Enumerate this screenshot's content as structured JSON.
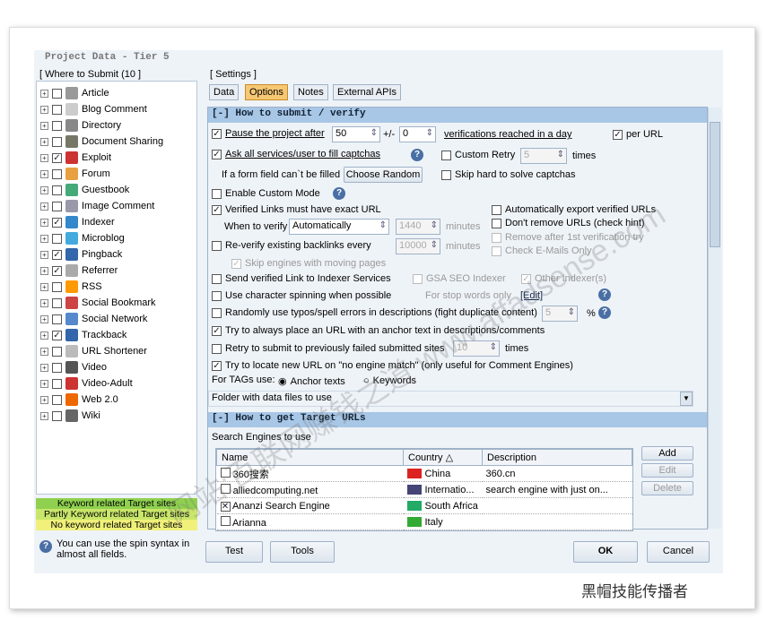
{
  "window": {
    "title": "Project Data - Tier 5"
  },
  "left": {
    "header": "[ Where to Submit  (10 ]",
    "items": [
      {
        "label": "Article",
        "checked": false,
        "color": "#999"
      },
      {
        "label": "Blog Comment",
        "checked": false,
        "color": "#ccc"
      },
      {
        "label": "Directory",
        "checked": false,
        "color": "#888"
      },
      {
        "label": "Document Sharing",
        "checked": false,
        "color": "#776"
      },
      {
        "label": "Exploit",
        "checked": true,
        "color": "#c33"
      },
      {
        "label": "Forum",
        "checked": false,
        "color": "#e8a040"
      },
      {
        "label": "Guestbook",
        "checked": false,
        "color": "#4a7"
      },
      {
        "label": "Image Comment",
        "checked": false,
        "color": "#99a"
      },
      {
        "label": "Indexer",
        "checked": true,
        "color": "#38c"
      },
      {
        "label": "Microblog",
        "checked": false,
        "color": "#4ad"
      },
      {
        "label": "Pingback",
        "checked": true,
        "color": "#36a"
      },
      {
        "label": "Referrer",
        "checked": true,
        "color": "#aaa"
      },
      {
        "label": "RSS",
        "checked": false,
        "color": "#f90"
      },
      {
        "label": "Social Bookmark",
        "checked": false,
        "color": "#c44"
      },
      {
        "label": "Social Network",
        "checked": false,
        "color": "#58c"
      },
      {
        "label": "Trackback",
        "checked": true,
        "color": "#36a"
      },
      {
        "label": "URL Shortener",
        "checked": false,
        "color": "#bbb"
      },
      {
        "label": "Video",
        "checked": false,
        "color": "#555"
      },
      {
        "label": "Video-Adult",
        "checked": false,
        "color": "#c33"
      },
      {
        "label": "Web 2.0",
        "checked": false,
        "color": "#e60"
      },
      {
        "label": "Wiki",
        "checked": false,
        "color": "#666"
      }
    ],
    "legend": [
      "Keyword related Target sites",
      "Partly Keyword related Target sites",
      "No keyword related Target sites"
    ],
    "hint": "You can use the spin syntax in almost all fields."
  },
  "settings": {
    "header": "[ Settings ]",
    "tabs": [
      "Data",
      "Options",
      "Notes",
      "External APIs"
    ],
    "active_tab": "Options"
  },
  "submit": {
    "header": "[-] How to submit / verify",
    "pause_label": "Pause the project after",
    "pause_value": "50",
    "plusminus": "+/-",
    "pause_var": "0",
    "verif_label": "verifications reached in a day",
    "per_url": "per URL",
    "ask_captcha": "Ask all services/user to fill captchas",
    "custom_retry": "Custom Retry",
    "retry_value": "5",
    "times": "times",
    "form_field": "If a form field can`t be filled",
    "choose_random": "Choose Random",
    "skip_hard": "Skip hard to solve captchas",
    "custom_mode": "Enable Custom Mode",
    "exact_url": "Verified Links must have exact URL",
    "auto_export": "Automatically export verified URLs",
    "when_verify": "When to verify",
    "when_value": "Automatically",
    "verify_minutes": "1440",
    "minutes": "minutes",
    "dont_remove": "Don't remove URLs (check hint)",
    "remove_after": "Remove after 1st verification try",
    "reverify": "Re-verify existing backlinks every",
    "reverify_minutes": "10000",
    "check_email": "Check E-Mails Only",
    "skip_moving": "Skip engines with moving pages",
    "send_indexer": "Send verified Link to Indexer Services",
    "gsa_indexer": "GSA SEO Indexer",
    "other_indexer": "Other Indexer(s)",
    "char_spin": "Use character spinning when possible",
    "stop_words": "For stop words only",
    "edit": "[Edit]",
    "typos": "Randomly use typos/spell errors in descriptions (fight duplicate content)",
    "typos_value": "5",
    "percent": "%",
    "anchor_url": "Try to always place an URL with an anchor text in descriptions/comments",
    "retry_failed": "Retry to submit to previously failed submitted sites",
    "retry_failed_value": "10",
    "locate_new": "Try to locate new URL on \"no engine match\" (only useful for Comment Engines)",
    "tags_label": "For TAGs use:",
    "anchor_texts": "Anchor texts",
    "keywords": "Keywords",
    "folder": "Folder with  data files to use"
  },
  "target": {
    "header": "[-] How to get Target URLs",
    "search_label": "Search Engines to use",
    "columns": [
      "Name",
      "Country △",
      "Description"
    ],
    "rows": [
      {
        "name": "360搜索",
        "country": "China",
        "desc": "360.cn",
        "checked": false,
        "flag": "#d22"
      },
      {
        "name": "alliedcomputing.net",
        "country": "Internatio...",
        "desc": "search engine with just on...",
        "checked": false,
        "flag": "#447"
      },
      {
        "name": "Ananzi Search Engine",
        "country": "South Africa",
        "desc": "",
        "checked": true,
        "flag": "#2a6"
      },
      {
        "name": "Arianna",
        "country": "Italy",
        "desc": "",
        "checked": false,
        "flag": "#3a3"
      }
    ],
    "add": "Add",
    "edit": "Edit",
    "delete": "Delete"
  },
  "buttons": {
    "test": "Test",
    "tools": "Tools",
    "ok": "OK",
    "cancel": "Cancel"
  },
  "watermark": {
    "brand": "黑帽技能传播者"
  }
}
